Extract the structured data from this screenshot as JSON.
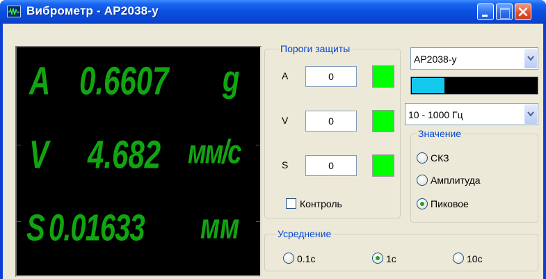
{
  "window": {
    "title": "Виброметр - AP2038-у"
  },
  "display": {
    "lines": [
      {
        "letter": "A",
        "value": "0.6607",
        "unit": "g"
      },
      {
        "letter": "V",
        "value": "4.682",
        "unit": "мм/с"
      },
      {
        "letter": "S",
        "value": "0.01633",
        "unit": "мм"
      }
    ],
    "color": "#11a511"
  },
  "thresholds": {
    "legend": "Пороги защиты",
    "rows": [
      {
        "label": "A",
        "value": "0"
      },
      {
        "label": "V",
        "value": "0"
      },
      {
        "label": "S",
        "value": "0"
      }
    ],
    "led_color": "#00ff00",
    "control_label": "Контроль"
  },
  "device": {
    "selected": "AP2038-у",
    "level_fraction": 0.26,
    "level_color": "#14c8ec"
  },
  "band": {
    "selected": "10 - 1000 Гц"
  },
  "value_group": {
    "legend": "Значение",
    "options": [
      {
        "label": "СКЗ",
        "selected": false
      },
      {
        "label": "Амплитуда",
        "selected": false
      },
      {
        "label": "Пиковое",
        "selected": true
      }
    ]
  },
  "averaging": {
    "legend": "Усреднение",
    "options": [
      {
        "label": "0.1с",
        "selected": false
      },
      {
        "label": "1с",
        "selected": true
      },
      {
        "label": "10с",
        "selected": false
      }
    ]
  },
  "icons": {
    "app": "waveform-icon",
    "minimize": "minimize-icon",
    "maximize": "maximize-icon",
    "close": "close-icon",
    "dropdown": "chevron-down-icon"
  }
}
